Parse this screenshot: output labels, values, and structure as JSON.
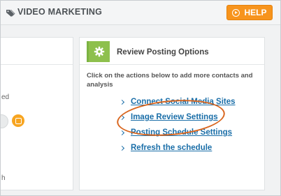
{
  "header": {
    "title": "VIDEO MARKETING",
    "help_label": "HELP",
    "icon": "tags-icon"
  },
  "left_panel": {
    "text_partial_1": "ed",
    "text_partial_2": "h"
  },
  "panel": {
    "title": "Review Posting Options",
    "description": "Click on the actions below to add more contacts and analysis",
    "links": [
      {
        "label": "Connect Social Media Sites"
      },
      {
        "label": "Image Review Settings"
      },
      {
        "label": "Posting Schedule Settings"
      },
      {
        "label": "Refresh the schedule"
      }
    ],
    "highlighted_link": "Image Review Settings"
  },
  "colors": {
    "accent_orange": "#f7941d",
    "accent_green": "#8ec04d",
    "link_blue": "#1a6ea8",
    "annotation_oval": "#d9661f"
  }
}
